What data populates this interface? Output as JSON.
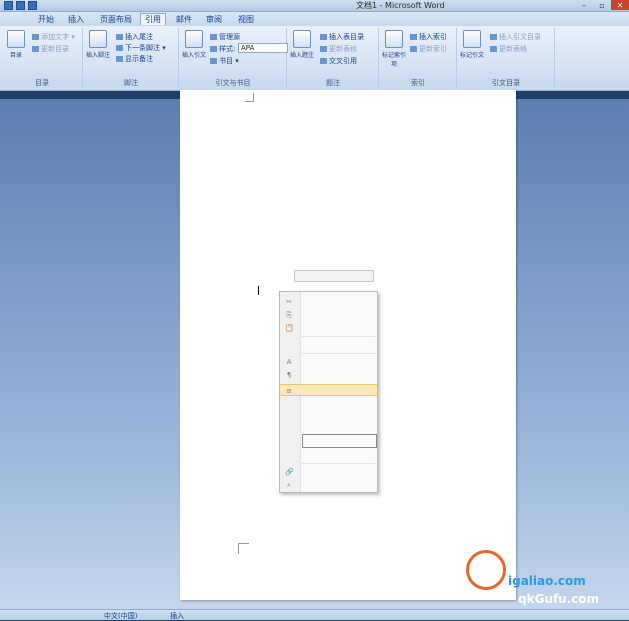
{
  "window": {
    "title": "文档1 - Microsoft Word",
    "controls": {
      "minimize": "–",
      "maximize": "▫",
      "close": "✕"
    }
  },
  "tabs": [
    {
      "label": "开始"
    },
    {
      "label": "插入"
    },
    {
      "label": "页面布局"
    },
    {
      "label": "引用",
      "active": true
    },
    {
      "label": "邮件"
    },
    {
      "label": "审阅"
    },
    {
      "label": "视图"
    }
  ],
  "ribbon": {
    "groups": {
      "toc": {
        "label": "目录",
        "big": "目录",
        "items": [
          "添加文字 ▾",
          "更新目录"
        ]
      },
      "footnotes": {
        "label": "脚注",
        "big": "插入脚注",
        "items": [
          "插入尾注",
          "下一条脚注 ▾",
          "显示备注"
        ]
      },
      "citations": {
        "label": "引文与书目",
        "big": "插入引文",
        "items": [
          "管理源",
          "样式:",
          "书目 ▾"
        ],
        "style_value": "APA"
      },
      "captions": {
        "label": "题注",
        "big": "插入题注",
        "items": [
          "插入表目录",
          "更新表格",
          "交叉引用"
        ]
      },
      "index": {
        "label": "索引",
        "big": "标记索引项",
        "items": [
          "插入索引",
          "更新索引"
        ]
      },
      "authorities": {
        "label": "引文目录",
        "big": "标记引文",
        "items": [
          "插入引文目录",
          "更新表格"
        ]
      }
    }
  },
  "document": {
    "lines": [
      "",
      "",
      "",
      "",
      "",
      "",
      "",
      "",
      "",
      "",
      "",
      "",
      "",
      "",
      "",
      "",
      "",
      "",
      "",
      "",
      "",
      "",
      "",
      "",
      "",
      "",
      "",
      ""
    ]
  },
  "floating_toolbar": "",
  "context_menu": {
    "items": [
      "",
      "",
      "",
      "",
      "",
      "",
      "",
      "",
      "",
      "",
      "",
      "",
      "",
      ""
    ]
  },
  "statusbar": {
    "page": "",
    "words": "",
    "language": "中文(中国)",
    "mode": "插入"
  },
  "watermark": {
    "logo_cn": "",
    "url": "igaliao.com",
    "url2": "qkGufu.com"
  }
}
